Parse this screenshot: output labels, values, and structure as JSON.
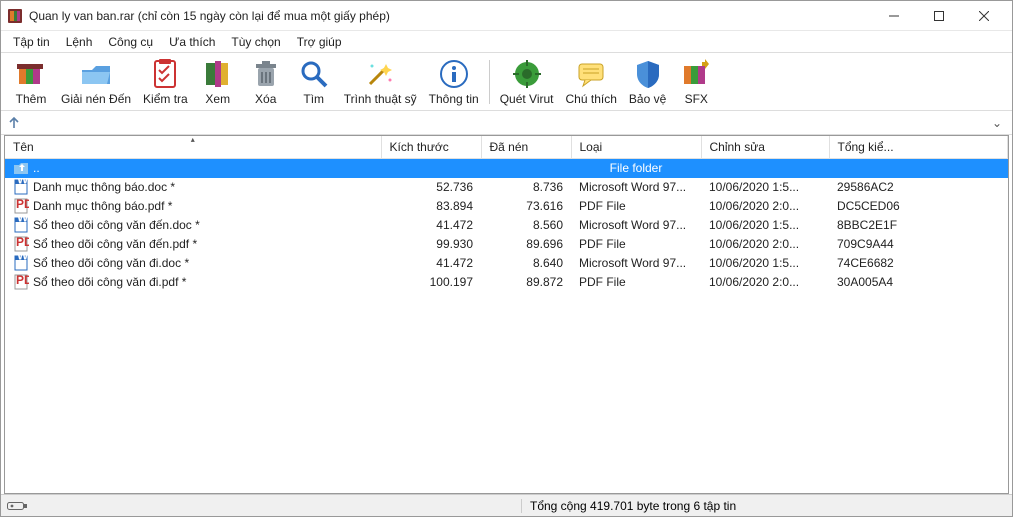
{
  "title": "Quan ly van ban.rar (chỉ còn 15 ngày còn lại để mua một giấy phép)",
  "menu": [
    "Tập tin",
    "Lệnh",
    "Công cụ",
    "Ưa thích",
    "Tùy chọn",
    "Trợ giúp"
  ],
  "toolbar": [
    {
      "key": "add",
      "label": "Thêm"
    },
    {
      "key": "extract",
      "label": "Giải nén Đến"
    },
    {
      "key": "test",
      "label": "Kiểm tra"
    },
    {
      "key": "view",
      "label": "Xem"
    },
    {
      "key": "delete",
      "label": "Xóa"
    },
    {
      "key": "find",
      "label": "Tìm"
    },
    {
      "key": "wizard",
      "label": "Trình thuật sỹ"
    },
    {
      "key": "info",
      "label": "Thông tin"
    },
    {
      "key": "sep"
    },
    {
      "key": "virus",
      "label": "Quét Virut"
    },
    {
      "key": "comment",
      "label": "Chú thích"
    },
    {
      "key": "protect",
      "label": "Bảo vệ"
    },
    {
      "key": "sfx",
      "label": "SFX"
    }
  ],
  "columns": {
    "name": "Tên",
    "size": "Kích thước",
    "packed": "Đã nén",
    "type": "Loại",
    "modified": "Chỉnh sửa",
    "crc": "Tổng kiể..."
  },
  "parent_row": {
    "name": "..",
    "type": "File folder"
  },
  "files": [
    {
      "icon": "doc",
      "name": "Danh mục thông báo.doc *",
      "size": "52.736",
      "packed": "8.736",
      "type": "Microsoft Word 97...",
      "modified": "10/06/2020 1:5...",
      "crc": "29586AC2"
    },
    {
      "icon": "pdf",
      "name": "Danh mục thông báo.pdf *",
      "size": "83.894",
      "packed": "73.616",
      "type": "PDF File",
      "modified": "10/06/2020 2:0...",
      "crc": "DC5CED06"
    },
    {
      "icon": "doc",
      "name": "Sổ theo dõi công văn đến.doc *",
      "size": "41.472",
      "packed": "8.560",
      "type": "Microsoft Word 97...",
      "modified": "10/06/2020 1:5...",
      "crc": "8BBC2E1F"
    },
    {
      "icon": "pdf",
      "name": "Sổ theo dõi công văn đến.pdf *",
      "size": "99.930",
      "packed": "89.696",
      "type": "PDF File",
      "modified": "10/06/2020 2:0...",
      "crc": "709C9A44"
    },
    {
      "icon": "doc",
      "name": "Sổ theo dõi công văn đi.doc *",
      "size": "41.472",
      "packed": "8.640",
      "type": "Microsoft Word 97...",
      "modified": "10/06/2020 1:5...",
      "crc": "74CE6682"
    },
    {
      "icon": "pdf",
      "name": "Sổ theo dõi công văn đi.pdf *",
      "size": "100.197",
      "packed": "89.872",
      "type": "PDF File",
      "modified": "10/06/2020 2:0...",
      "crc": "30A005A4"
    }
  ],
  "status": {
    "right": "Tổng cộng 419.701 byte trong 6 tập tin"
  }
}
